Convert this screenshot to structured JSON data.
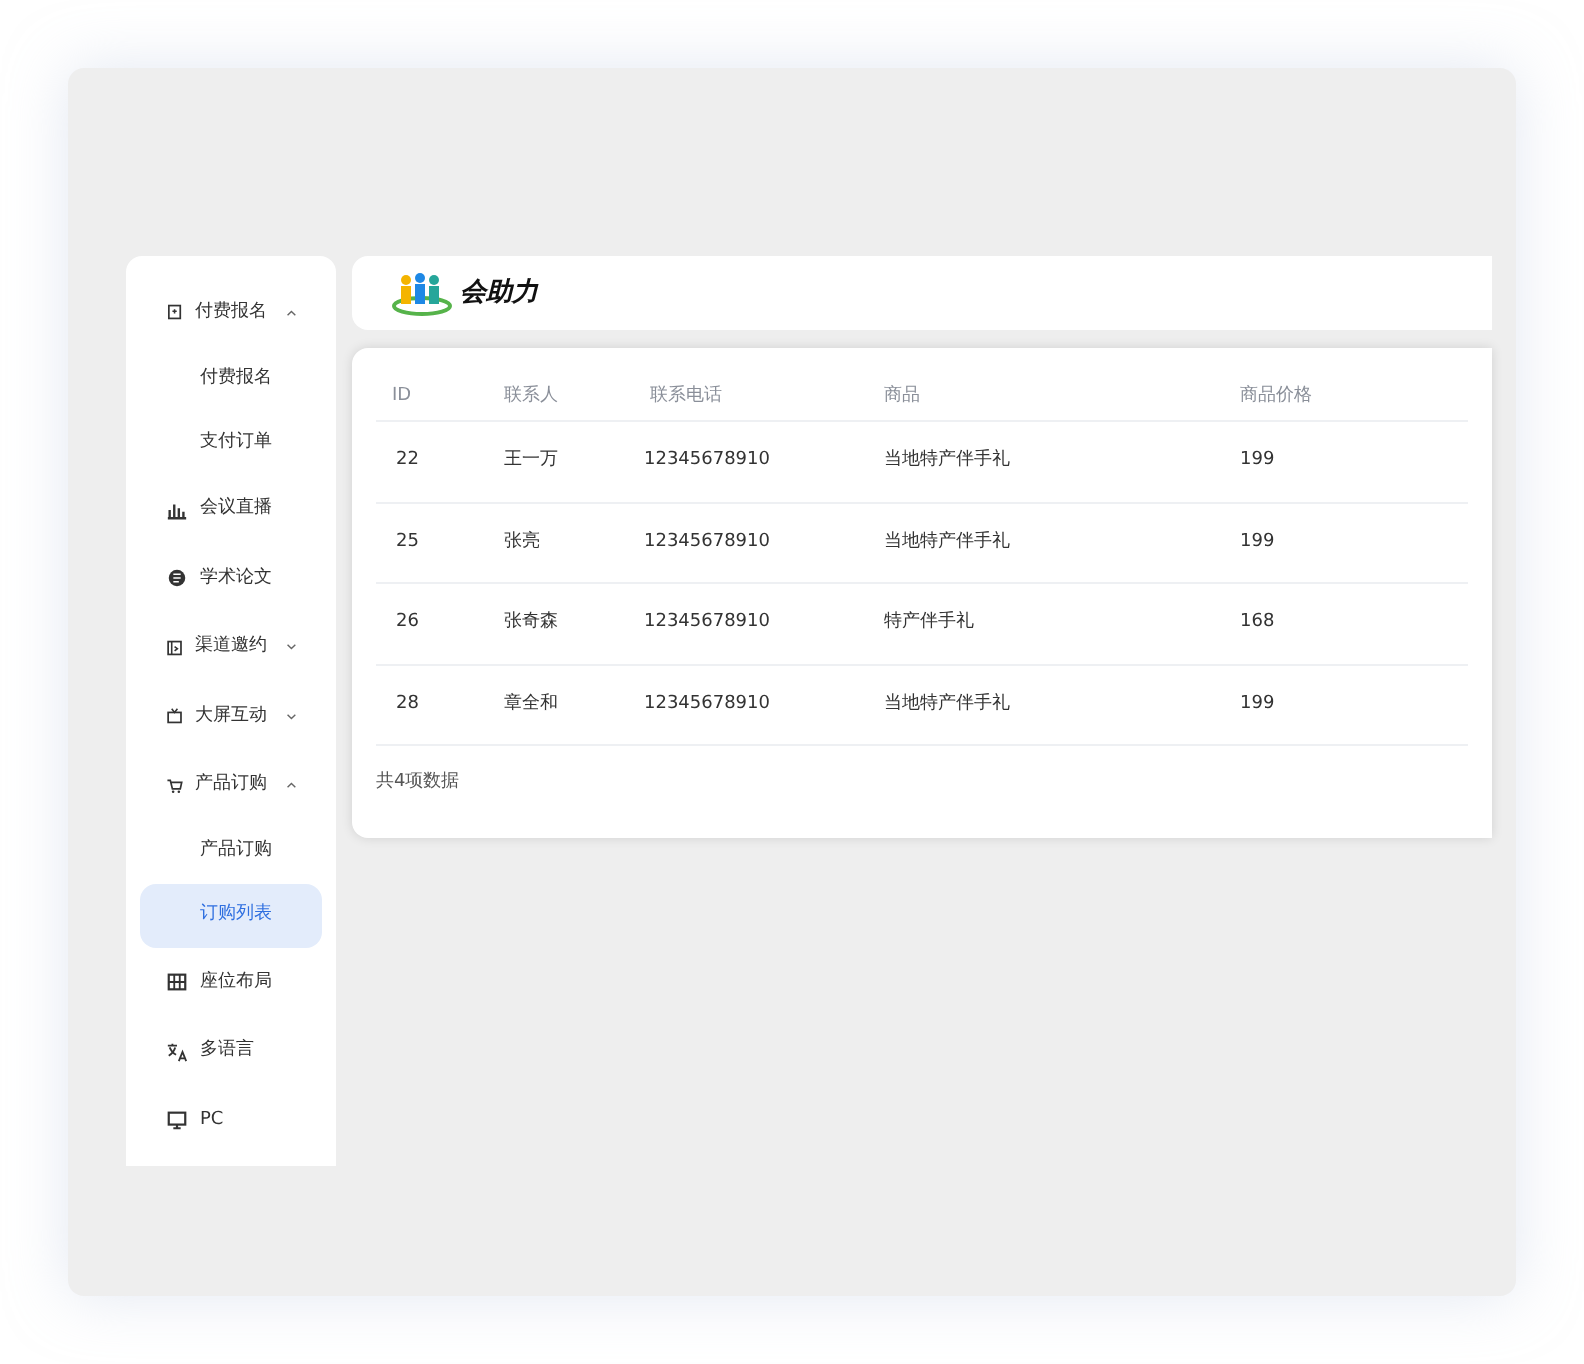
{
  "sidebar": {
    "items": [
      {
        "kind": "group",
        "label": "付费报名",
        "expanded": true,
        "children": [
          {
            "label": "付费报名",
            "selected": false
          },
          {
            "label": "支付订单",
            "selected": false
          }
        ]
      },
      {
        "kind": "item",
        "label": "会议直播",
        "selected": false
      },
      {
        "kind": "item",
        "label": "学术论文",
        "selected": false
      },
      {
        "kind": "group",
        "label": "渠道邀约",
        "expanded": false
      },
      {
        "kind": "group",
        "label": "大屏互动",
        "expanded": false
      },
      {
        "kind": "group",
        "label": "产品订购",
        "expanded": true,
        "children": [
          {
            "label": "产品订购",
            "selected": false
          },
          {
            "label": "订购列表",
            "selected": true
          }
        ]
      },
      {
        "kind": "item",
        "label": "座位布局",
        "selected": false
      },
      {
        "kind": "item",
        "label": "多语言",
        "selected": false
      },
      {
        "kind": "item",
        "label": "PC",
        "selected": false
      }
    ]
  },
  "header": {
    "logo_text": "会助力"
  },
  "table": {
    "columns": [
      "ID",
      "联系人",
      "联系电话",
      "商品",
      "商品价格"
    ],
    "rows": [
      [
        "22",
        "王一万",
        "12345678910",
        "当地特产伴手礼",
        "199"
      ],
      [
        "25",
        "张亮",
        "12345678910",
        "当地特产伴手礼",
        "199"
      ],
      [
        "26",
        "张奇森",
        "12345678910",
        "特产伴手礼",
        "168"
      ],
      [
        "28",
        "章全和",
        "12345678910",
        "当地特产伴手礼",
        "199"
      ]
    ],
    "footer": "共4项数据"
  }
}
